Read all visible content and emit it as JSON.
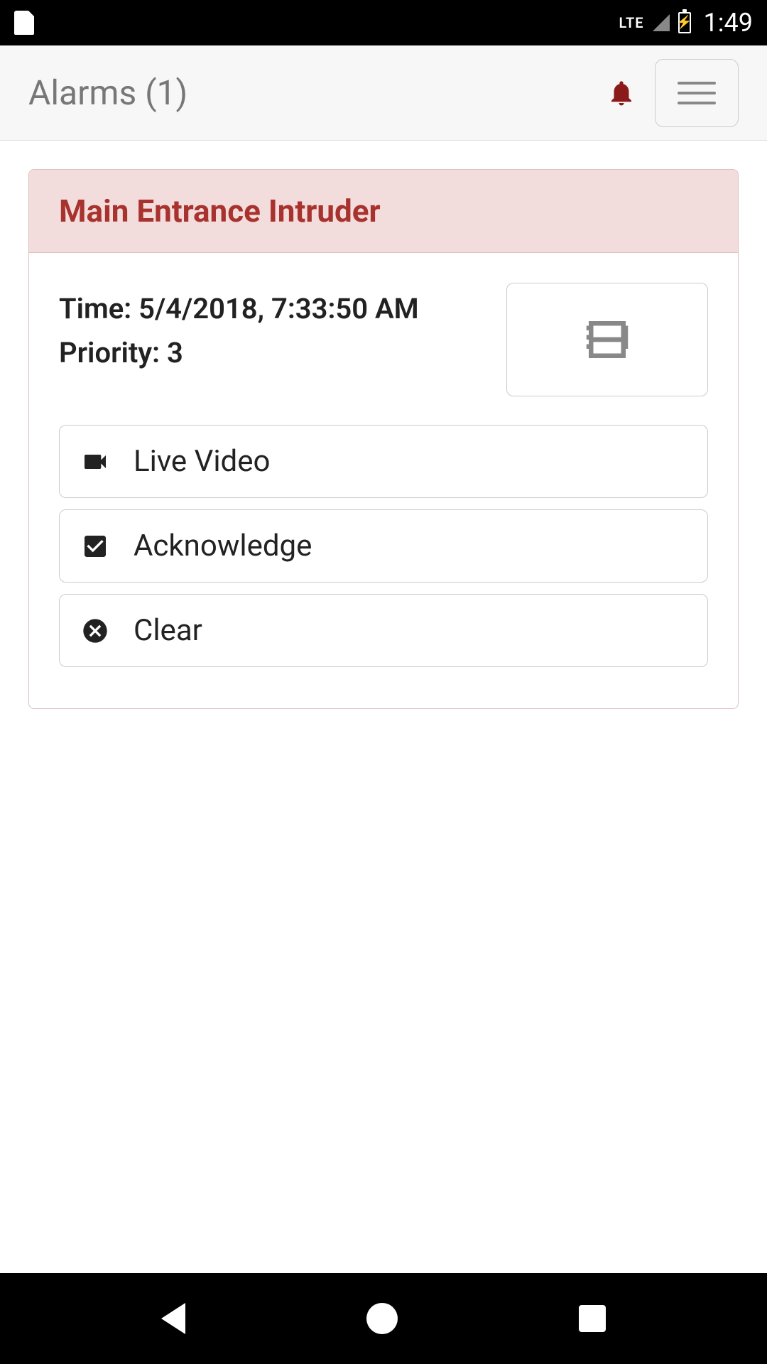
{
  "status_bar": {
    "lte_label": "LTE",
    "clock": "1:49"
  },
  "header": {
    "title": "Alarms (1)"
  },
  "alarm": {
    "title": "Main Entrance Intruder",
    "time_label": "Time:",
    "time_value": "5/4/2018, 7:33:50 AM",
    "priority_label": "Priority:",
    "priority_value": "3",
    "actions": {
      "live_video": "Live Video",
      "acknowledge": "Acknowledge",
      "clear": "Clear"
    }
  },
  "colors": {
    "accent": "#a8322e",
    "card_header_bg": "#f2dcdc"
  }
}
